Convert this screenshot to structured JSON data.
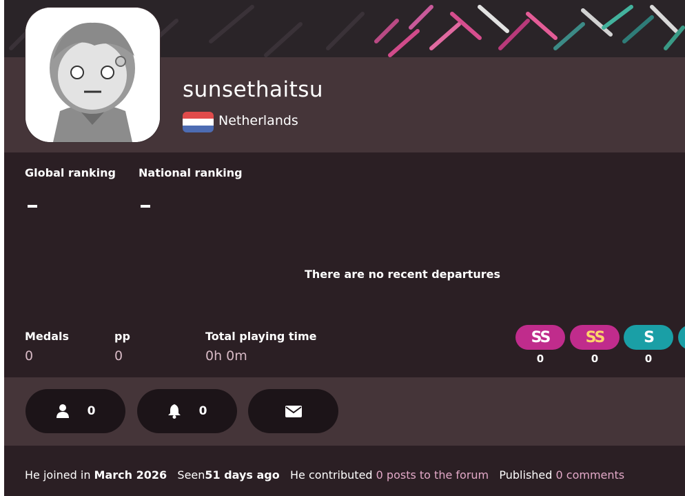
{
  "profile": {
    "username": "sunsethaitsu",
    "country": "Netherlands"
  },
  "rankings": {
    "global_label": "Global ranking",
    "global_value": "-",
    "national_label": "National ranking",
    "national_value": "-"
  },
  "departures_message": "There are no recent departures",
  "stats": {
    "medals_label": "Medals",
    "medals_value": "0",
    "pp_label": "pp",
    "pp_value": "0",
    "playtime_label": "Total playing time",
    "playtime_value": "0h 0m"
  },
  "grades": [
    {
      "label": "SS",
      "count": "0",
      "color": "#c02c8c"
    },
    {
      "label": "SS",
      "count": "0",
      "color": "#c02c8c"
    },
    {
      "label": "S",
      "count": "0",
      "color": "#1a9fa6"
    }
  ],
  "actions": {
    "friends_count": "0",
    "followers_count": "0"
  },
  "footer": {
    "joined_prefix": "He joined in ",
    "joined_date": "March 2026",
    "seen_prefix": "Seen",
    "seen_value": "51 days ago",
    "contributed_prefix": "He contributed ",
    "posts_link": "0 posts to the forum",
    "published_prefix": "Published ",
    "comments_link": "0 comments"
  },
  "icons": {
    "friends": "user-icon",
    "followers": "bell-icon",
    "message": "envelope-icon"
  }
}
